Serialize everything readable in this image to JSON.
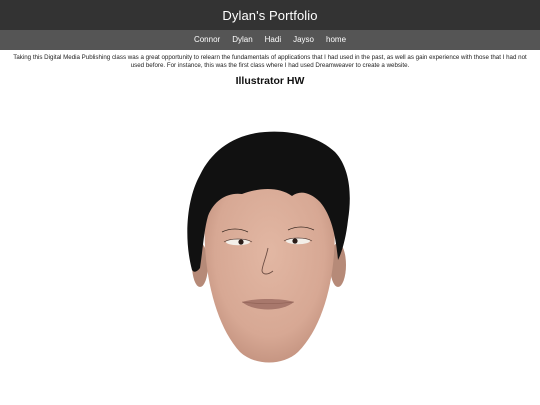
{
  "header": {
    "title": "Dylan's Portfolio"
  },
  "nav": {
    "items": [
      {
        "label": "Connor"
      },
      {
        "label": "Dylan"
      },
      {
        "label": "Hadi"
      },
      {
        "label": "Jayso"
      },
      {
        "label": "home"
      }
    ]
  },
  "main": {
    "intro": "Taking this Digital Media Publishing class was a great opportunity to relearn the fundamentals of applications that I had used in the past, as well as gain experience with those that I had not used before. For instance, this was the first class where I had used Dreamweaver to create a website.",
    "heading": "Illustrator HW",
    "artwork": "face-illustration"
  },
  "colors": {
    "title_bar": "#333333",
    "nav_bar": "#555555",
    "skin": "#d9ac98",
    "hair": "#111111",
    "lips": "#a8786c"
  }
}
